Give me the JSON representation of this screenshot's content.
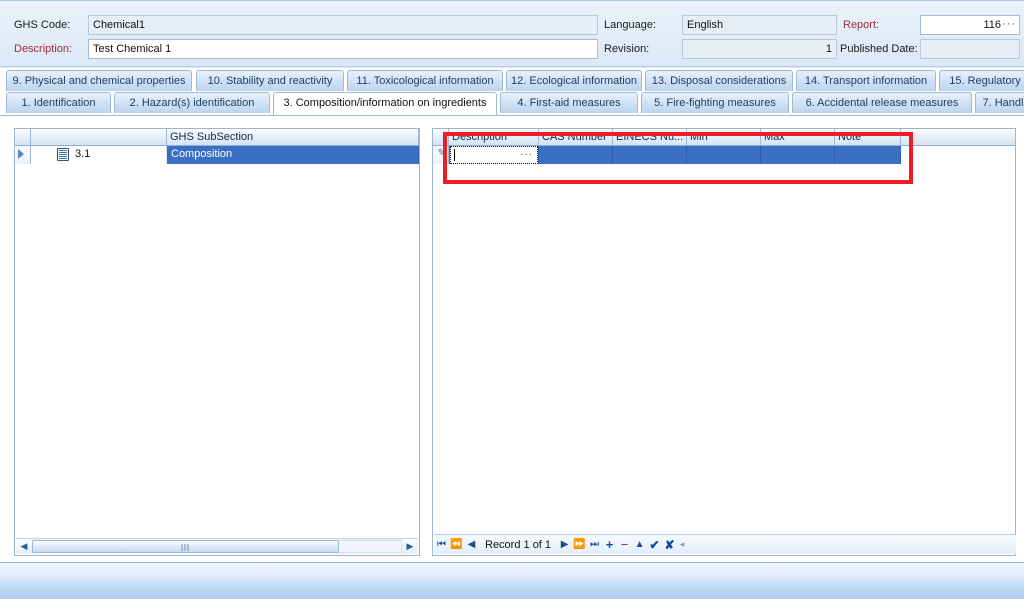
{
  "header": {
    "fields": [
      {
        "label": "GHS Code:",
        "value": "Chemical1",
        "required": false,
        "readonly": true
      },
      {
        "label": "Description:",
        "value": "Test Chemical 1",
        "required": true,
        "readonly": false
      },
      {
        "label": "Language:",
        "value": "English",
        "required": false,
        "readonly": true
      },
      {
        "label": "Revision:",
        "value": "1",
        "required": false,
        "readonly": true
      },
      {
        "label": "Report:",
        "value": "116",
        "required": true,
        "readonly": false
      },
      {
        "label": "Published Date:",
        "value": "",
        "required": false,
        "readonly": true
      }
    ],
    "ellipsis_glyph": "···"
  },
  "tabs": {
    "top_row": [
      "9. Physical and chemical properties",
      "10. Stability and reactivity",
      "11. Toxicological information",
      "12. Ecological information",
      "13. Disposal considerations",
      "14. Transport information",
      "15. Regulatory"
    ],
    "bottom_row": [
      "1. Identification",
      "2. Hazard(s) identification",
      "3. Composition/information on ingredients",
      "4. First-aid measures",
      "5. Fire-fighting measures",
      "6. Accidental release measures",
      "7. Handl"
    ],
    "active": "3. Composition/information on ingredients"
  },
  "left_grid": {
    "columns": [
      "",
      "",
      "GHS SubSection"
    ],
    "rows": [
      {
        "indicator": "chevron-right",
        "icon": "document-icon",
        "number": "3.1",
        "subsection": "Composition",
        "selected": true
      }
    ],
    "scrollbar": {
      "left_arrow": "◀",
      "right_arrow": "▶"
    }
  },
  "right_grid": {
    "columns": [
      "Description",
      "CAS Number",
      "EINECS Nu...",
      "Min",
      "Max",
      "Note"
    ],
    "rows": [
      {
        "state": "editing",
        "description": "",
        "cas_number": "",
        "einecs_number": "",
        "min": "",
        "max": "",
        "note": ""
      }
    ],
    "editor_ellipsis": "···",
    "navigator": {
      "first": "⏮",
      "prev_page": "⏪",
      "prev": "◀",
      "record_text": "Record 1 of 1",
      "next": "▶",
      "next_page": "⏩",
      "last": "⏭",
      "add": "+",
      "delete": "−",
      "edit": "▲",
      "post": "✔",
      "cancel": "✘",
      "separator": "◂"
    }
  },
  "annotation": {
    "type": "red-rectangle-highlight",
    "color": "#ee1c24",
    "target": "right-grid-new-record-row"
  }
}
